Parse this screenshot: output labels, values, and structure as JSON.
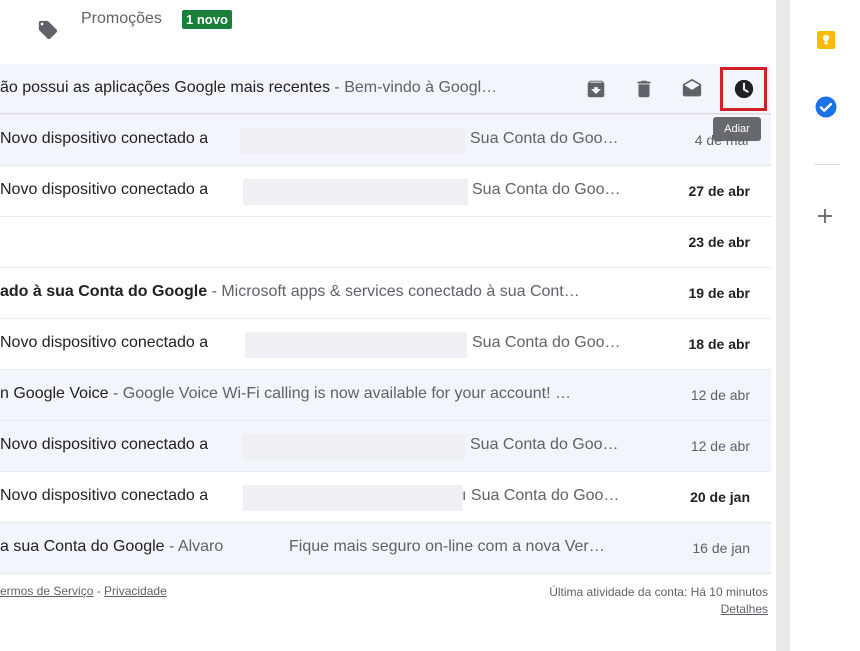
{
  "promotions": {
    "label": "Promoções",
    "badge": "1 novo"
  },
  "hover_row": {
    "subject": "ão possui as aplicações Google mais recentes",
    "snippet": " - Bem-vindo à Googl…",
    "tooltip": "Adiar"
  },
  "rows": [
    {
      "subject": " Novo dispositivo conectado a",
      "tail": "Sua Conta do Goo…",
      "date": "4 de mar"
    },
    {
      "subject": " Novo dispositivo conectado a",
      "tail": "Sua Conta do Goo…",
      "date": "27 de abr"
    },
    {
      "subject": "",
      "tail": "",
      "date": "23 de abr"
    },
    {
      "subject": "ado à sua Conta do Google",
      "snippet": " - Microsoft apps & services conectado à sua Cont…",
      "date": "19 de abr"
    },
    {
      "subject": " Novo dispositivo conectado a",
      "tail": "Sua Conta do Goo…",
      "date": "18 de abr"
    },
    {
      "subject": "n Google Voice",
      "snippet": " - Google Voice Wi-Fi calling is now available for your account! …",
      "date": "12 de abr"
    },
    {
      "subject": " Novo dispositivo conectado a",
      "tail": "Sua Conta do Goo…",
      "date": "12 de abr"
    },
    {
      "subject": " Novo dispositivo conectado a",
      "tail": "ı Sua Conta do Goo…",
      "date": "20 de jan"
    },
    {
      "subject": "a sua Conta do Google",
      "snippet": " - Alvaro",
      "tail": "Fique mais seguro on-line com a nova Ver…",
      "date": "16 de jan"
    }
  ],
  "footer": {
    "terms": "ermos de Serviço",
    "sep": " - ",
    "privacy": "Privacidade",
    "activity": "Última atividade da conta: Há 10 minutos",
    "details": "Detalhes"
  },
  "colors": {
    "badge": "#188038",
    "highlight": "#d32027",
    "keep": "#fbbc04",
    "tasks": "#1a73e8"
  }
}
